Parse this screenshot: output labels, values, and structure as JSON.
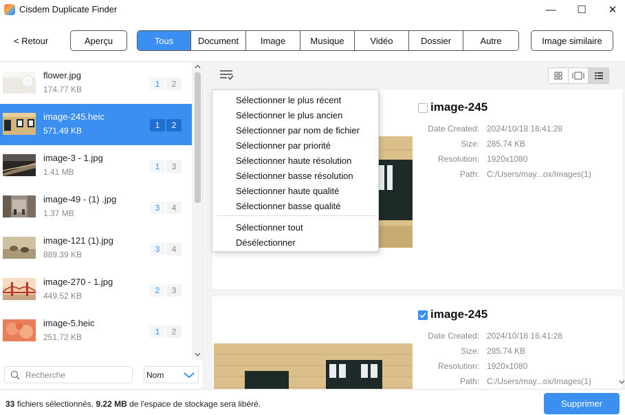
{
  "window": {
    "title": "Cisdem Duplicate Finder",
    "minimize": "—",
    "maximize": "☐",
    "close": "✕"
  },
  "toolbar": {
    "back_label": "< Retour",
    "preview_label": "Aperçu",
    "similar_label": "Image similaire",
    "tabs": [
      {
        "label": "Tous",
        "active": true
      },
      {
        "label": "Document",
        "active": false
      },
      {
        "label": "Image",
        "active": false
      },
      {
        "label": "Musique",
        "active": false
      },
      {
        "label": "Vidéo",
        "active": false
      },
      {
        "label": "Dossier",
        "active": false
      },
      {
        "label": "Autre",
        "active": false
      }
    ]
  },
  "file_list": [
    {
      "name": "flower.jpg",
      "size": "174.77 KB",
      "count_selected": "1",
      "count_total": "2",
      "selected": false,
      "thumb": "flower"
    },
    {
      "name": "image-245.heic",
      "size": "571.49 KB",
      "count_selected": "1",
      "count_total": "2",
      "selected": true,
      "thumb": "wall"
    },
    {
      "name": "image-3 - 1.jpg",
      "size": "1.41 MB",
      "count_selected": "1",
      "count_total": "3",
      "selected": false,
      "thumb": "road"
    },
    {
      "name": "image-49 - (1)  .jpg",
      "size": "1.37 MB",
      "count_selected": "3",
      "count_total": "4",
      "selected": false,
      "thumb": "street"
    },
    {
      "name": "image-121 (1).jpg",
      "size": "889.39 KB",
      "count_selected": "3",
      "count_total": "4",
      "selected": false,
      "thumb": "animals"
    },
    {
      "name": "image-270 - 1.jpg",
      "size": "449.52 KB",
      "count_selected": "2",
      "count_total": "3",
      "selected": false,
      "thumb": "bridge"
    },
    {
      "name": "image-5.heic",
      "size": "251.72 KB",
      "count_selected": "1",
      "count_total": "2",
      "selected": false,
      "thumb": "petals"
    }
  ],
  "search": {
    "placeholder": "Recherche"
  },
  "sort": {
    "value": "Nom"
  },
  "menu": {
    "items": [
      "Sélectionner le plus récent",
      "Sélectionner le plus ancien",
      "Sélectionner par nom de fichier",
      "Sélectionner par priorité",
      "Sélectionner haute résolution",
      "Sélectionner basse résolution",
      "Sélectionner haute qualité",
      "Sélectionner basse qualité",
      "Sélectionner tout",
      "Désélectionner"
    ]
  },
  "cards": [
    {
      "title": "image-245",
      "checked": false,
      "date_label": "Date Created:",
      "date": "2024/10/18 16:41:28",
      "size_label": "Size:",
      "size": "285.74 KB",
      "res_label": "Resolution:",
      "resolution": "1920x1080",
      "path_label": "Path:",
      "path": "C:/Users/may...ox/Images(1)"
    },
    {
      "title": "image-245",
      "checked": true,
      "date_label": "Date Created:",
      "date": "2024/10/18 16:41:28",
      "size_label": "Size:",
      "size": "285.74 KB",
      "res_label": "Resolution:",
      "resolution": "1920x1080",
      "path_label": "Path:",
      "path": "C:/Users/may...ox/Images(1)"
    }
  ],
  "status": {
    "count": "33",
    "count_text": " fichiers sélectionnés.  ",
    "size": "9.22 MB",
    "size_text": "  de l'espace de stockage sera libéré.",
    "delete_label": "Supprimer"
  },
  "colors": {
    "accent": "#3b8ff0"
  }
}
